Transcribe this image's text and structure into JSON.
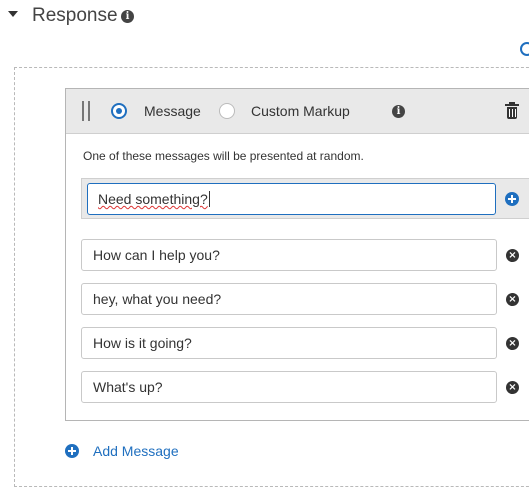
{
  "section": {
    "title": "Response"
  },
  "card": {
    "mode_options": [
      "Message",
      "Custom Markup"
    ],
    "selected_mode": "Message",
    "hint": "One of these messages will be presented at random.",
    "active_message": "Need something?",
    "messages": [
      "How can I help you?",
      "hey, what you need?",
      "How is it going?",
      "What's up?"
    ]
  },
  "actions": {
    "add_message_label": "Add Message"
  },
  "colors": {
    "accent": "#1f6fbf",
    "toolbar_bg": "#e9e9e9"
  },
  "icons": {
    "info": "info-icon",
    "trash": "trash-icon",
    "add": "plus-circle-icon",
    "remove": "x-circle-icon",
    "drag": "drag-handle-icon"
  }
}
